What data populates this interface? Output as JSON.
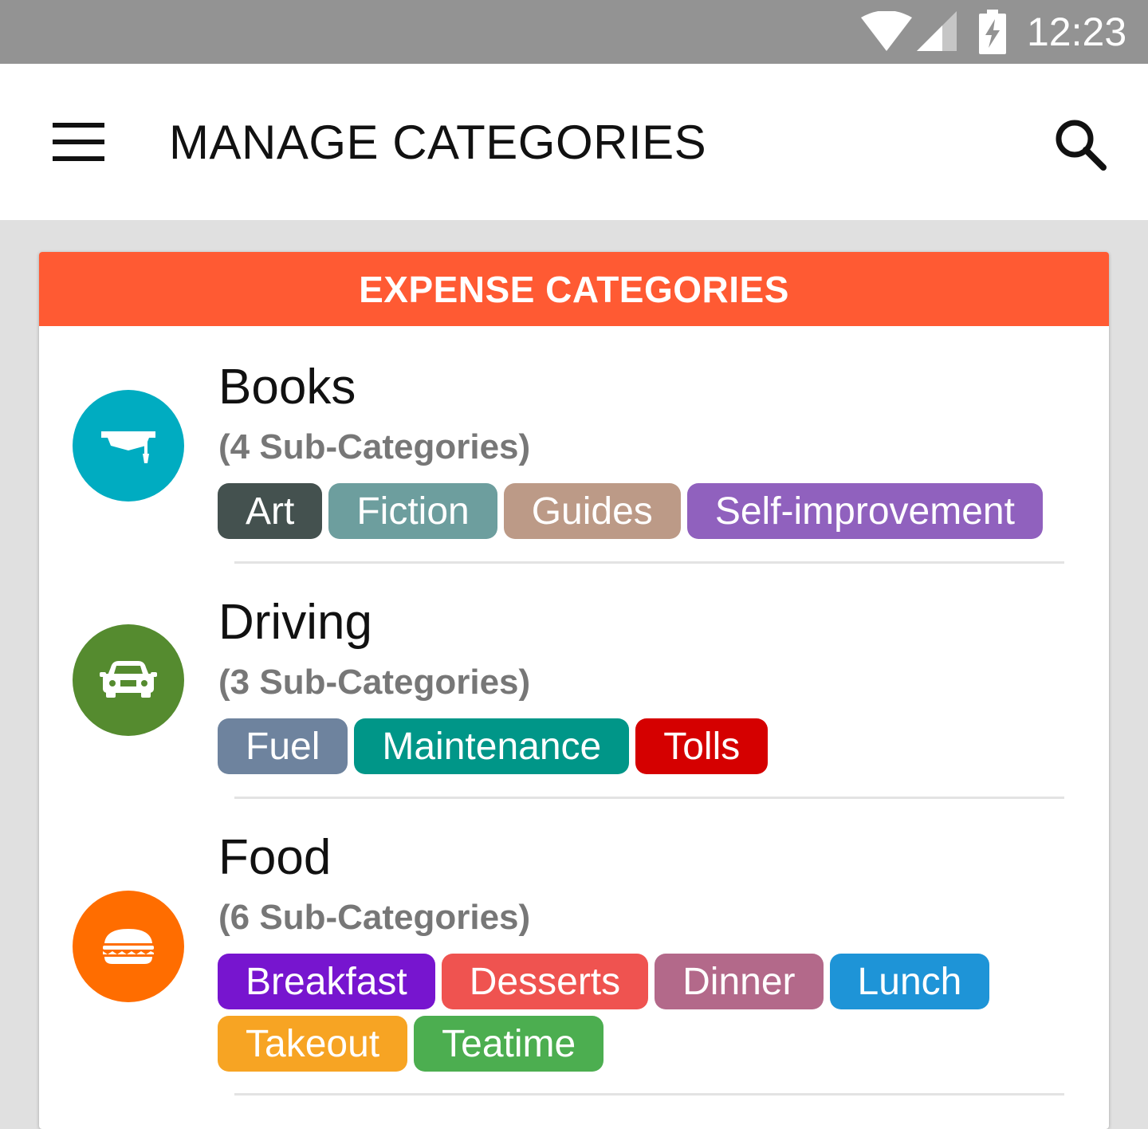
{
  "status_bar": {
    "time": "12:23",
    "icons": [
      "wifi-icon",
      "cell-signal-icon",
      "battery-charging-icon"
    ]
  },
  "app_bar": {
    "title": "MANAGE CATEGORIES",
    "menu_icon": "hamburger-menu-icon",
    "search_icon": "search-icon"
  },
  "card": {
    "header": "EXPENSE CATEGORIES",
    "header_color": "#ff5a33",
    "categories": [
      {
        "name": "Books",
        "count_text": "(4 Sub-Categories)",
        "icon": "graduation-cap-icon",
        "color": "#00acc1",
        "subcategories": [
          {
            "label": "Art",
            "color": "#44514f"
          },
          {
            "label": "Fiction",
            "color": "#6d9e9e"
          },
          {
            "label": "Guides",
            "color": "#bc9a87"
          },
          {
            "label": "Self-improvement",
            "color": "#9061be"
          }
        ]
      },
      {
        "name": "Driving",
        "count_text": "(3 Sub-Categories)",
        "icon": "car-icon",
        "color": "#558b2f",
        "subcategories": [
          {
            "label": "Fuel",
            "color": "#6e839e"
          },
          {
            "label": "Maintenance",
            "color": "#009688"
          },
          {
            "label": "Tolls",
            "color": "#d50000"
          }
        ]
      },
      {
        "name": "Food",
        "count_text": "(6 Sub-Categories)",
        "icon": "burger-icon",
        "color": "#ff6d00",
        "subcategories": [
          {
            "label": "Breakfast",
            "color": "#7715cf"
          },
          {
            "label": "Desserts",
            "color": "#ef5350"
          },
          {
            "label": "Dinner",
            "color": "#b3698a"
          },
          {
            "label": "Lunch",
            "color": "#1e94d7"
          },
          {
            "label": "Takeout",
            "color": "#f7a423"
          },
          {
            "label": "Teatime",
            "color": "#4cae50"
          }
        ]
      }
    ]
  }
}
